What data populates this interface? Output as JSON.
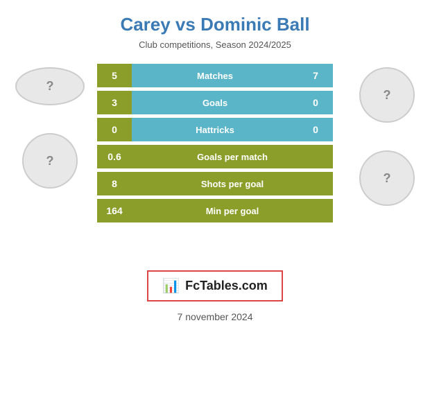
{
  "header": {
    "title": "Carey vs Dominic Ball",
    "subtitle": "Club competitions, Season 2024/2025"
  },
  "stats": [
    {
      "label": "Matches",
      "left_value": "5",
      "right_value": "7",
      "type": "blue"
    },
    {
      "label": "Goals",
      "left_value": "3",
      "right_value": "0",
      "type": "blue"
    },
    {
      "label": "Hattricks",
      "left_value": "0",
      "right_value": "0",
      "type": "blue"
    },
    {
      "label": "Goals per match",
      "left_value": "0.6",
      "right_value": null,
      "type": "olive"
    },
    {
      "label": "Shots per goal",
      "left_value": "8",
      "right_value": null,
      "type": "olive"
    },
    {
      "label": "Min per goal",
      "left_value": "164",
      "right_value": null,
      "type": "olive"
    }
  ],
  "branding": {
    "text": "FcTables.com"
  },
  "date": "7 november 2024",
  "avatars": {
    "left_top_icon": "?",
    "left_mid_icon": "?",
    "right_top_icon": "?",
    "right_mid_icon": "?"
  }
}
